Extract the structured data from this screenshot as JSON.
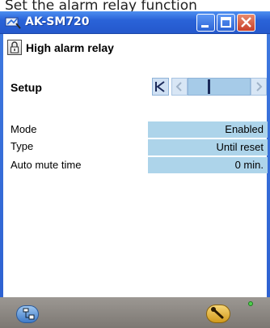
{
  "caption": {
    "text": "Set the alarm relay function"
  },
  "window": {
    "title": "AK-SM720",
    "controls": {
      "minimize": "minimize-icon",
      "maximize": "maximize-icon",
      "close": "close-icon"
    }
  },
  "page": {
    "title": "High alarm relay",
    "section": "Setup",
    "lock_icon": "lock-icon"
  },
  "navigation": {
    "first_icon": "first-page-icon",
    "prev_icon": "previous-icon",
    "next_icon": "next-icon"
  },
  "settings": [
    {
      "label": "Mode",
      "value": "Enabled"
    },
    {
      "label": "Type",
      "value": "Until reset"
    },
    {
      "label": "Auto mute time",
      "value": "0 min."
    }
  ],
  "statusbar": {
    "tree_icon": "tree-view-icon",
    "wrench_icon": "wrench-icon",
    "status_led_color": "#4fd04f"
  },
  "colors": {
    "titlebar": "#2a63d8",
    "value_field": "#add4ea",
    "statusbar": "#8a8580"
  }
}
